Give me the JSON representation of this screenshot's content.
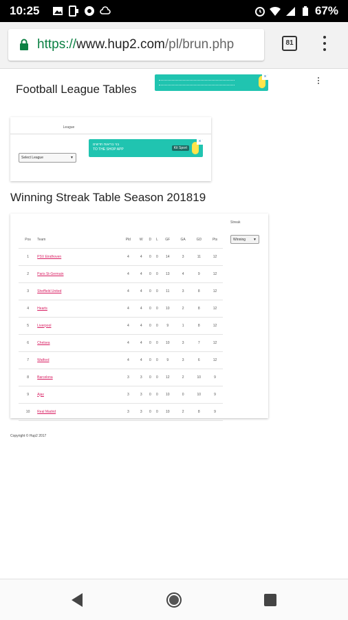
{
  "status_bar": {
    "time": "10:25",
    "battery": "67%"
  },
  "browser": {
    "url_scheme": "https://",
    "url_host": "www.hup2.com",
    "url_path": "/pl/brun.php",
    "tab_count": "81"
  },
  "page": {
    "site_title": "Football League Tables",
    "league_card": {
      "label": "League",
      "select_value": "Select League"
    },
    "ad_mid": {
      "text_line1": "בני בריאות חדשים",
      "text_line2": "TO THE SHOP APP",
      "button": "Kit Sport"
    },
    "section_title": "Winning Streak Table Season 201819",
    "streak": {
      "label": "Streak",
      "select_value": "Winning"
    },
    "table": {
      "headers": [
        "Pos",
        "Team",
        "Pld",
        "W",
        "D",
        "L",
        "GF",
        "GA",
        "GD",
        "Pts"
      ],
      "rows": [
        [
          "1",
          "PSV Eindhoven",
          "4",
          "4",
          "0",
          "0",
          "14",
          "3",
          "11",
          "12"
        ],
        [
          "2",
          "Paris St-Germain",
          "4",
          "4",
          "0",
          "0",
          "13",
          "4",
          "9",
          "12"
        ],
        [
          "3",
          "Sheffield United",
          "4",
          "4",
          "0",
          "0",
          "11",
          "3",
          "8",
          "12"
        ],
        [
          "4",
          "Hearts",
          "4",
          "4",
          "0",
          "0",
          "10",
          "2",
          "8",
          "12"
        ],
        [
          "5",
          "Liverpool",
          "4",
          "4",
          "0",
          "0",
          "9",
          "1",
          "8",
          "12"
        ],
        [
          "6",
          "Chelsea",
          "4",
          "4",
          "0",
          "0",
          "10",
          "3",
          "7",
          "12"
        ],
        [
          "7",
          "Watford",
          "4",
          "4",
          "0",
          "0",
          "9",
          "3",
          "6",
          "12"
        ],
        [
          "8",
          "Barcelona",
          "3",
          "3",
          "0",
          "0",
          "12",
          "2",
          "10",
          "9"
        ],
        [
          "9",
          "Ajax",
          "3",
          "3",
          "0",
          "0",
          "10",
          "0",
          "10",
          "9"
        ],
        [
          "10",
          "Real Madrid",
          "3",
          "3",
          "0",
          "0",
          "10",
          "2",
          "8",
          "9"
        ]
      ]
    },
    "copyright": "Copyright © Hup2 2017"
  },
  "colors": {
    "link": "#d81b60",
    "ad": "#20c4b0",
    "secure": "#0b8043"
  }
}
